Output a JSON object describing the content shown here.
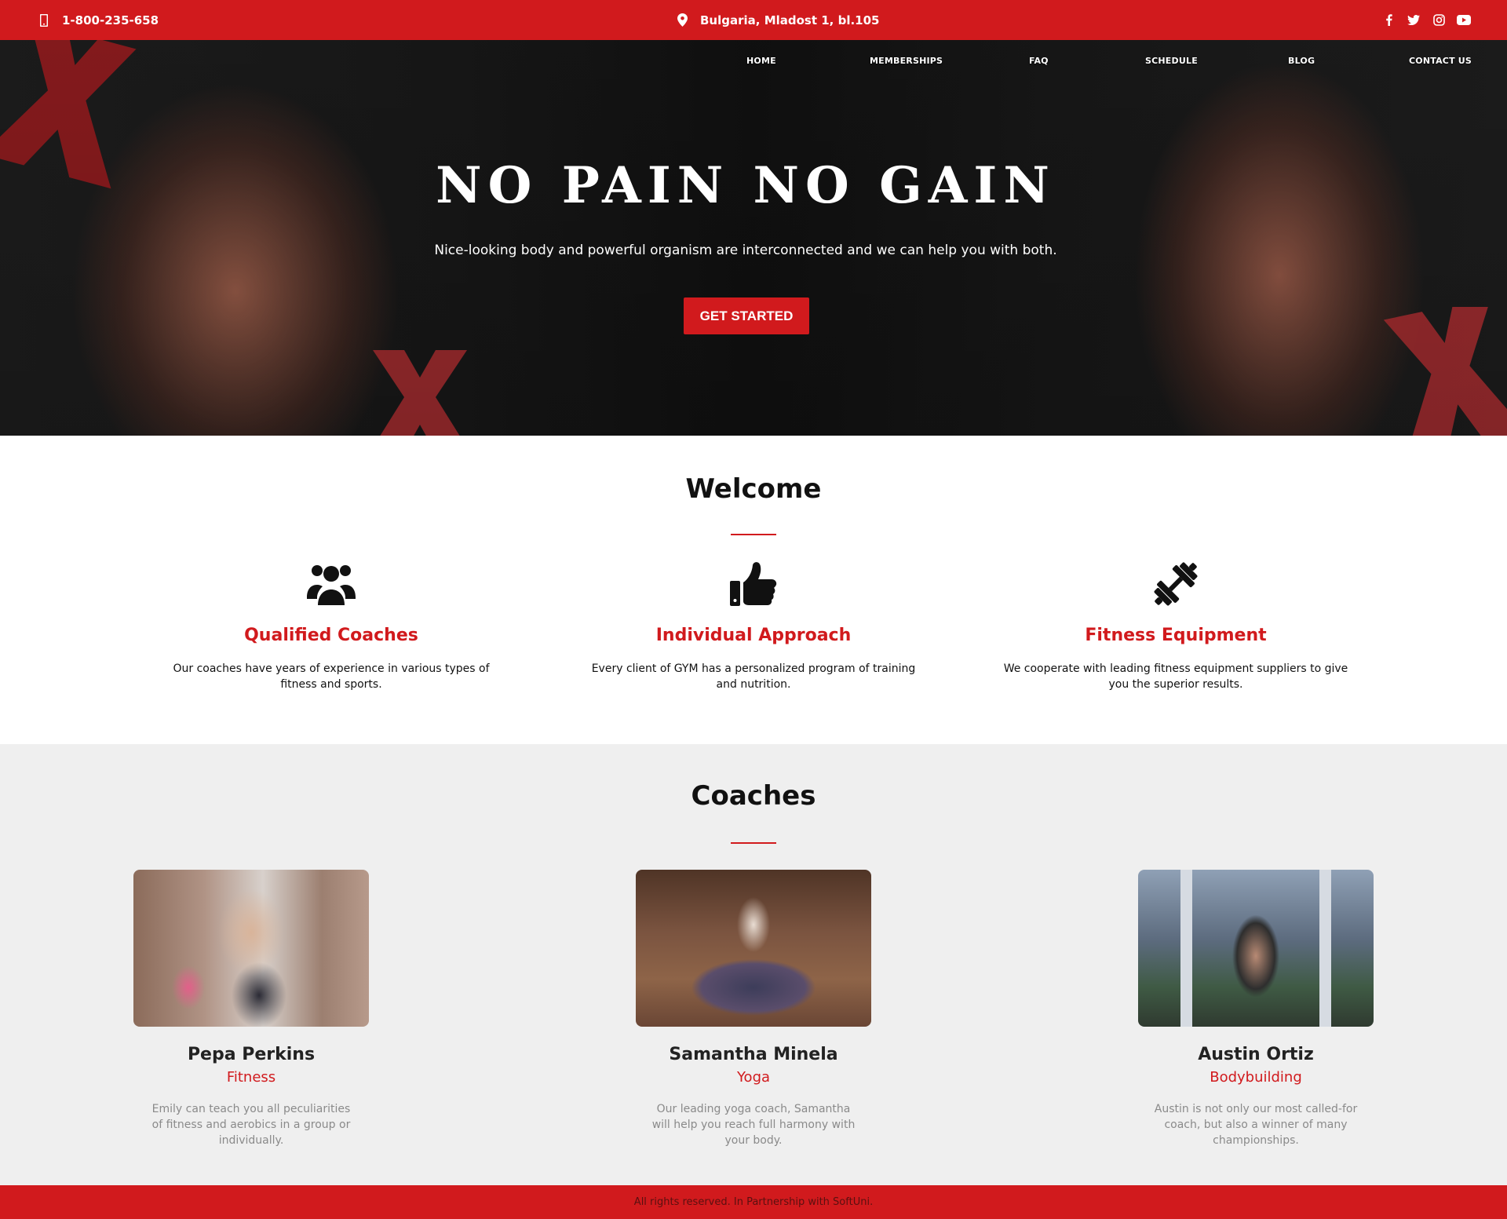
{
  "topbar": {
    "phone": "1-800-235-658",
    "address": "Bulgaria, Mladost 1, bl.105",
    "social": [
      "facebook-icon",
      "twitter-icon",
      "instagram-icon",
      "youtube-icon"
    ]
  },
  "nav": {
    "items": [
      "HOME",
      "MEMBERSHIPS",
      "FAQ",
      "SCHEDULE",
      "BLOG",
      "CONTACT US"
    ]
  },
  "hero": {
    "title": "NO PAIN NO GAIN",
    "subtitle": "Nice-looking body and powerful organism are interconnected and we can help you with both.",
    "cta": "GET STARTED"
  },
  "welcome": {
    "title": "Welcome",
    "features": [
      {
        "icon": "users-icon",
        "title": "Qualified Coaches",
        "text": "Our coaches have years of experience in various types of fitness and sports."
      },
      {
        "icon": "thumbs-up-icon",
        "title": "Individual Approach",
        "text": "Every client of GYM has a personalized program of training and nutrition."
      },
      {
        "icon": "dumbbell-icon",
        "title": "Fitness Equipment",
        "text": "We cooperate with leading fitness equipment suppliers to give you the superior results."
      }
    ]
  },
  "coaches": {
    "title": "Coaches",
    "items": [
      {
        "name": "Pepa Perkins",
        "role": "Fitness",
        "text": "Emily can teach you all peculiarities of fitness and aerobics in a group or individually."
      },
      {
        "name": "Samantha Minela",
        "role": "Yoga",
        "text": "Our leading yoga coach, Samantha will help you reach full harmony with your body."
      },
      {
        "name": "Austin Ortiz",
        "role": "Bodybuilding",
        "text": "Austin is not only our most called-for coach, but also a winner of many championships."
      }
    ]
  },
  "footer": {
    "text": "All rights reserved. In Partnership with SoftUni."
  },
  "colors": {
    "accent": "#d11a1d",
    "section_bg": "#efefef"
  }
}
